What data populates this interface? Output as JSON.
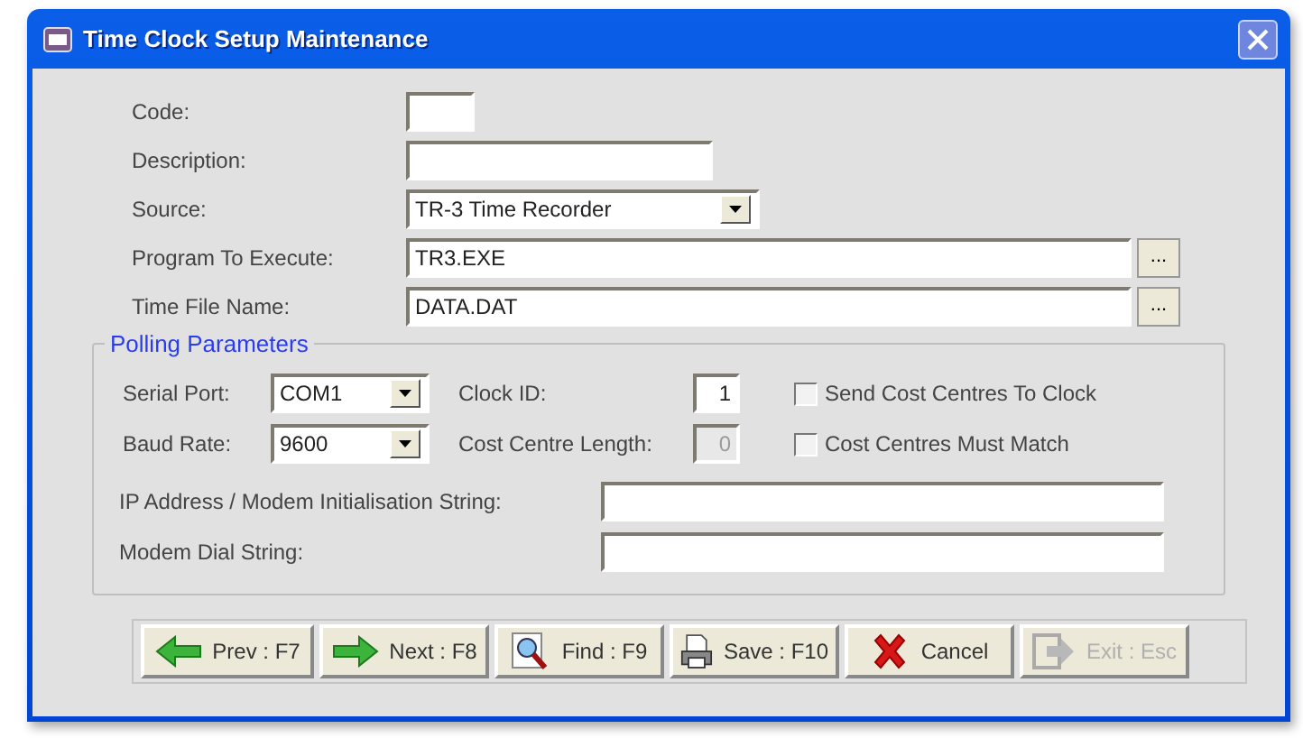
{
  "window": {
    "title": "Time Clock Setup Maintenance"
  },
  "fields": [
    {
      "label": "Code:",
      "kind": "text"
    },
    {
      "label": "Description:",
      "kind": "text"
    },
    {
      "label": "Source:",
      "kind": "combo",
      "value": "TR-3 Time Recorder"
    },
    {
      "label": "Program To Execute:",
      "kind": "browse",
      "value": "TR3.EXE",
      "button": "..."
    },
    {
      "label": "Time File Name:",
      "kind": "browse",
      "value": "DATA.DAT",
      "button": "..."
    }
  ],
  "polling": {
    "title": "Polling Parameters",
    "serial_port": {
      "label": "Serial Port:",
      "value": "COM1"
    },
    "baud_rate": {
      "label": "Baud Rate:",
      "value": "9600"
    },
    "clock_id": {
      "label": "Clock ID:",
      "value": "1",
      "disabled": false
    },
    "cost_centre_length": {
      "label": "Cost Centre Length:",
      "value": "0",
      "disabled": true
    },
    "checkboxes": [
      {
        "label": "Send Cost Centres To Clock",
        "checked": false
      },
      {
        "label": "Cost Centres Must Match",
        "checked": false
      }
    ],
    "ip_address": {
      "label": "IP Address / Modem Initialisation String:"
    },
    "dial_string": {
      "label": "Modem Dial String:"
    }
  },
  "buttons": [
    {
      "label": "Prev : F7",
      "disabled": false
    },
    {
      "label": "Next : F8",
      "disabled": false
    },
    {
      "label": "Find : F9",
      "disabled": false
    },
    {
      "label": "Save : F10",
      "disabled": false
    },
    {
      "label": "Cancel",
      "disabled": false
    },
    {
      "label": "Exit : Esc",
      "disabled": true
    }
  ]
}
